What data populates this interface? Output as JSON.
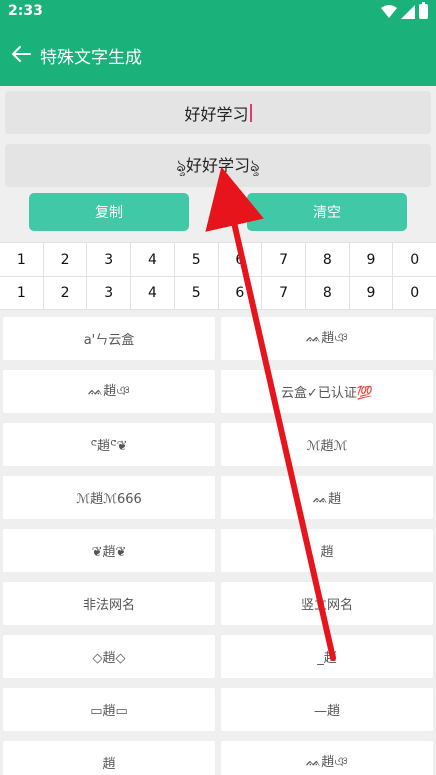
{
  "status": {
    "time": "2:33"
  },
  "appbar": {
    "title": "特殊文字生成"
  },
  "input": {
    "value": "好好学习"
  },
  "output": {
    "value": "ৡ好好学习ৡ"
  },
  "buttons": {
    "copy": "复制",
    "clear": "清空"
  },
  "number_rows": [
    [
      "1",
      "2",
      "3",
      "4",
      "5",
      "6",
      "7",
      "8",
      "9",
      "0"
    ],
    [
      "1",
      "2",
      "3",
      "4",
      "5",
      "6",
      "7",
      "8",
      "9",
      "0"
    ]
  ],
  "styles": [
    "a'ㄣ云盒",
    "ᨐ趙ঞ",
    "ᨐ趙ঞ",
    "云盒✓已认证💯",
    "ᕪ趙ᕪ❦",
    "ℳ趙ℳ",
    "ℳ趙ℳ666",
    "ᨐ趙",
    "❦趙❦",
    "趙",
    "非法网名",
    "竖立网名",
    "◇趙◇",
    "_趙",
    "▭趙▭",
    "—趙",
    "趙",
    "ᨐ趙ঞ"
  ],
  "colors": {
    "primary": "#1ab27a",
    "button": "#41c8a6",
    "arrow": "#e8141c"
  }
}
